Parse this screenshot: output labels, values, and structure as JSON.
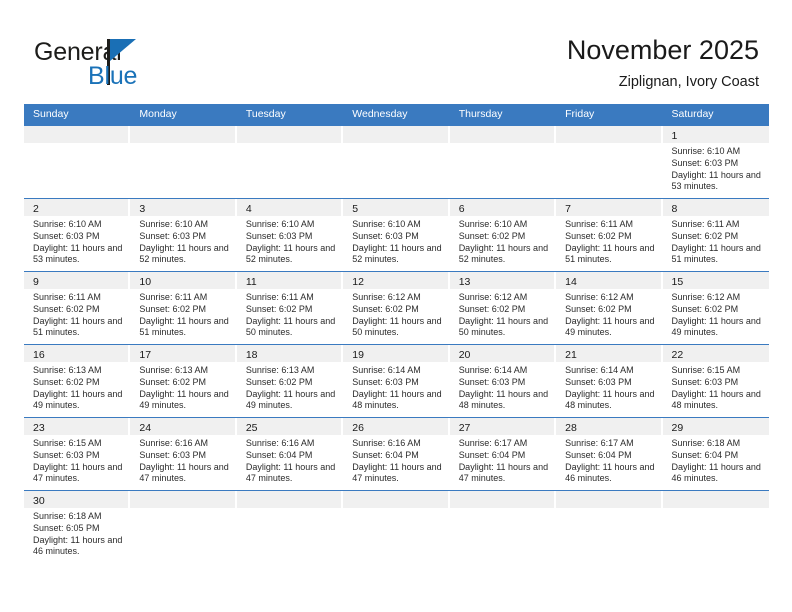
{
  "brand": {
    "name_top": "General",
    "name_bottom": "Blue",
    "logo_icon": "general-blue-logo"
  },
  "header": {
    "title": "November 2025",
    "subtitle": "Ziplignan, Ivory Coast"
  },
  "colors": {
    "header_blue": "#3a7ac0",
    "brand_blue": "#1a72b8",
    "day_band_gray": "#f0f0f0",
    "text": "#1a1a1a"
  },
  "weekdays": [
    "Sunday",
    "Monday",
    "Tuesday",
    "Wednesday",
    "Thursday",
    "Friday",
    "Saturday"
  ],
  "labels": {
    "sunrise": "Sunrise:",
    "sunset": "Sunset:",
    "daylight": "Daylight:"
  },
  "weeks": [
    [
      {
        "day": "",
        "sunrise": "",
        "sunset": "",
        "daylight": ""
      },
      {
        "day": "",
        "sunrise": "",
        "sunset": "",
        "daylight": ""
      },
      {
        "day": "",
        "sunrise": "",
        "sunset": "",
        "daylight": ""
      },
      {
        "day": "",
        "sunrise": "",
        "sunset": "",
        "daylight": ""
      },
      {
        "day": "",
        "sunrise": "",
        "sunset": "",
        "daylight": ""
      },
      {
        "day": "",
        "sunrise": "",
        "sunset": "",
        "daylight": ""
      },
      {
        "day": "1",
        "sunrise": "Sunrise: 6:10 AM",
        "sunset": "Sunset: 6:03 PM",
        "daylight": "Daylight: 11 hours and 53 minutes."
      }
    ],
    [
      {
        "day": "2",
        "sunrise": "Sunrise: 6:10 AM",
        "sunset": "Sunset: 6:03 PM",
        "daylight": "Daylight: 11 hours and 53 minutes."
      },
      {
        "day": "3",
        "sunrise": "Sunrise: 6:10 AM",
        "sunset": "Sunset: 6:03 PM",
        "daylight": "Daylight: 11 hours and 52 minutes."
      },
      {
        "day": "4",
        "sunrise": "Sunrise: 6:10 AM",
        "sunset": "Sunset: 6:03 PM",
        "daylight": "Daylight: 11 hours and 52 minutes."
      },
      {
        "day": "5",
        "sunrise": "Sunrise: 6:10 AM",
        "sunset": "Sunset: 6:03 PM",
        "daylight": "Daylight: 11 hours and 52 minutes."
      },
      {
        "day": "6",
        "sunrise": "Sunrise: 6:10 AM",
        "sunset": "Sunset: 6:02 PM",
        "daylight": "Daylight: 11 hours and 52 minutes."
      },
      {
        "day": "7",
        "sunrise": "Sunrise: 6:11 AM",
        "sunset": "Sunset: 6:02 PM",
        "daylight": "Daylight: 11 hours and 51 minutes."
      },
      {
        "day": "8",
        "sunrise": "Sunrise: 6:11 AM",
        "sunset": "Sunset: 6:02 PM",
        "daylight": "Daylight: 11 hours and 51 minutes."
      }
    ],
    [
      {
        "day": "9",
        "sunrise": "Sunrise: 6:11 AM",
        "sunset": "Sunset: 6:02 PM",
        "daylight": "Daylight: 11 hours and 51 minutes."
      },
      {
        "day": "10",
        "sunrise": "Sunrise: 6:11 AM",
        "sunset": "Sunset: 6:02 PM",
        "daylight": "Daylight: 11 hours and 51 minutes."
      },
      {
        "day": "11",
        "sunrise": "Sunrise: 6:11 AM",
        "sunset": "Sunset: 6:02 PM",
        "daylight": "Daylight: 11 hours and 50 minutes."
      },
      {
        "day": "12",
        "sunrise": "Sunrise: 6:12 AM",
        "sunset": "Sunset: 6:02 PM",
        "daylight": "Daylight: 11 hours and 50 minutes."
      },
      {
        "day": "13",
        "sunrise": "Sunrise: 6:12 AM",
        "sunset": "Sunset: 6:02 PM",
        "daylight": "Daylight: 11 hours and 50 minutes."
      },
      {
        "day": "14",
        "sunrise": "Sunrise: 6:12 AM",
        "sunset": "Sunset: 6:02 PM",
        "daylight": "Daylight: 11 hours and 49 minutes."
      },
      {
        "day": "15",
        "sunrise": "Sunrise: 6:12 AM",
        "sunset": "Sunset: 6:02 PM",
        "daylight": "Daylight: 11 hours and 49 minutes."
      }
    ],
    [
      {
        "day": "16",
        "sunrise": "Sunrise: 6:13 AM",
        "sunset": "Sunset: 6:02 PM",
        "daylight": "Daylight: 11 hours and 49 minutes."
      },
      {
        "day": "17",
        "sunrise": "Sunrise: 6:13 AM",
        "sunset": "Sunset: 6:02 PM",
        "daylight": "Daylight: 11 hours and 49 minutes."
      },
      {
        "day": "18",
        "sunrise": "Sunrise: 6:13 AM",
        "sunset": "Sunset: 6:02 PM",
        "daylight": "Daylight: 11 hours and 49 minutes."
      },
      {
        "day": "19",
        "sunrise": "Sunrise: 6:14 AM",
        "sunset": "Sunset: 6:03 PM",
        "daylight": "Daylight: 11 hours and 48 minutes."
      },
      {
        "day": "20",
        "sunrise": "Sunrise: 6:14 AM",
        "sunset": "Sunset: 6:03 PM",
        "daylight": "Daylight: 11 hours and 48 minutes."
      },
      {
        "day": "21",
        "sunrise": "Sunrise: 6:14 AM",
        "sunset": "Sunset: 6:03 PM",
        "daylight": "Daylight: 11 hours and 48 minutes."
      },
      {
        "day": "22",
        "sunrise": "Sunrise: 6:15 AM",
        "sunset": "Sunset: 6:03 PM",
        "daylight": "Daylight: 11 hours and 48 minutes."
      }
    ],
    [
      {
        "day": "23",
        "sunrise": "Sunrise: 6:15 AM",
        "sunset": "Sunset: 6:03 PM",
        "daylight": "Daylight: 11 hours and 47 minutes."
      },
      {
        "day": "24",
        "sunrise": "Sunrise: 6:16 AM",
        "sunset": "Sunset: 6:03 PM",
        "daylight": "Daylight: 11 hours and 47 minutes."
      },
      {
        "day": "25",
        "sunrise": "Sunrise: 6:16 AM",
        "sunset": "Sunset: 6:04 PM",
        "daylight": "Daylight: 11 hours and 47 minutes."
      },
      {
        "day": "26",
        "sunrise": "Sunrise: 6:16 AM",
        "sunset": "Sunset: 6:04 PM",
        "daylight": "Daylight: 11 hours and 47 minutes."
      },
      {
        "day": "27",
        "sunrise": "Sunrise: 6:17 AM",
        "sunset": "Sunset: 6:04 PM",
        "daylight": "Daylight: 11 hours and 47 minutes."
      },
      {
        "day": "28",
        "sunrise": "Sunrise: 6:17 AM",
        "sunset": "Sunset: 6:04 PM",
        "daylight": "Daylight: 11 hours and 46 minutes."
      },
      {
        "day": "29",
        "sunrise": "Sunrise: 6:18 AM",
        "sunset": "Sunset: 6:04 PM",
        "daylight": "Daylight: 11 hours and 46 minutes."
      }
    ],
    [
      {
        "day": "30",
        "sunrise": "Sunrise: 6:18 AM",
        "sunset": "Sunset: 6:05 PM",
        "daylight": "Daylight: 11 hours and 46 minutes."
      },
      {
        "day": "",
        "sunrise": "",
        "sunset": "",
        "daylight": ""
      },
      {
        "day": "",
        "sunrise": "",
        "sunset": "",
        "daylight": ""
      },
      {
        "day": "",
        "sunrise": "",
        "sunset": "",
        "daylight": ""
      },
      {
        "day": "",
        "sunrise": "",
        "sunset": "",
        "daylight": ""
      },
      {
        "day": "",
        "sunrise": "",
        "sunset": "",
        "daylight": ""
      },
      {
        "day": "",
        "sunrise": "",
        "sunset": "",
        "daylight": ""
      }
    ]
  ]
}
